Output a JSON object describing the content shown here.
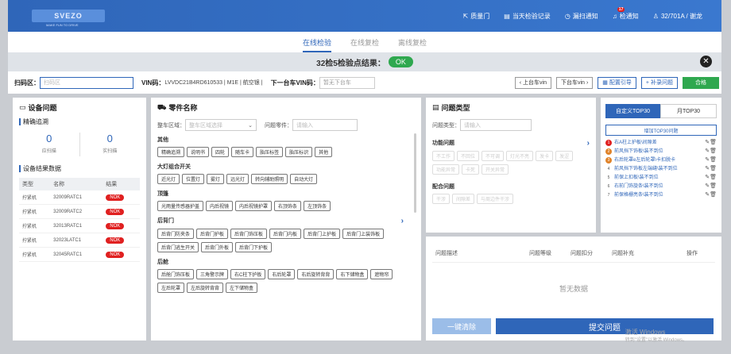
{
  "header": {
    "logo": "SVEZO",
    "logo_sub": "MAKE FUN TO DRIVE",
    "nav": [
      {
        "label": "质量门",
        "icon": "share-icon"
      },
      {
        "label": "当天检验记录",
        "icon": "list-icon"
      },
      {
        "label": "漏扫通知",
        "icon": "clock-icon"
      },
      {
        "label": "检通知",
        "icon": "bell-icon",
        "badge": "17"
      },
      {
        "label": "32/701A / 谢龙",
        "icon": "user-icon"
      }
    ]
  },
  "tabs": [
    "在线检验",
    "在线复检",
    "离线复检"
  ],
  "result": {
    "label": "32检5检验点结果：",
    "status": "OK"
  },
  "scan": {
    "scan_label": "扫码区：",
    "scan_placeholder": "扫码区",
    "vin_label": "VIN码：",
    "vin_value": "LVVDC21B4RD610533 | M1E | 航空银 |",
    "next_label": "下一台车VIN码：",
    "next_placeholder": "暂无下台车",
    "buttons": {
      "prev": "上台车vin",
      "next": "下台车vin",
      "config": "配置引导",
      "supplement": "补录问题",
      "pass": "合格"
    }
  },
  "device": {
    "title": "设备问题",
    "precise": "精确追溯",
    "scanned_count": "0",
    "scanned_label": "应扫描",
    "actual_count": "0",
    "actual_label": "实扫描",
    "data_title": "设备结果数据",
    "cols": [
      "类型",
      "名称",
      "结果"
    ],
    "rows": [
      {
        "type": "拧紧机",
        "name": "32009RATC1",
        "result": "NOK"
      },
      {
        "type": "拧紧机",
        "name": "32009RATC2",
        "result": "NOK"
      },
      {
        "type": "拧紧机",
        "name": "32013RATC1",
        "result": "NOK"
      },
      {
        "type": "拧紧机",
        "name": "32023LATC1",
        "result": "NOK"
      },
      {
        "type": "拧紧机",
        "name": "32045RATC1",
        "result": "NOK"
      }
    ]
  },
  "parts": {
    "title": "零件名称",
    "area_label": "整车区域：",
    "area_placeholder": "整车区域选择",
    "part_label": "问题零件：",
    "part_placeholder": "请输入",
    "groups": [
      {
        "name": "其他",
        "items": [
          "精确追溯",
          "说明书",
          "四轮",
          "随车卡",
          "胎压标签",
          "胎压标识",
          "其他"
        ]
      },
      {
        "name": "大灯组合开关",
        "items": [
          "近光灯",
          "位置灯",
          "雾灯",
          "远光灯",
          "转向辅助照明",
          "自动大灯"
        ]
      },
      {
        "name": "顶篷",
        "items": [
          "光雨量传感器护盖",
          "内后视镜",
          "内后视镜护罩",
          "右顶饰条",
          "左顶饰条"
        ]
      },
      {
        "name": "后背门",
        "items": [
          "后背门防夹条",
          "后背门护板",
          "后背门饰压板",
          "后背门内板",
          "后背门上护板",
          "后背门上装饰板",
          "后背门逃生开关",
          "后背门外板",
          "后背门下护板"
        ]
      },
      {
        "name": "后舱",
        "items": [
          "后舱门饰压板",
          "三角警示牌",
          "右C柱下护板",
          "右后轮罩",
          "右后旋转背背",
          "右下储物盒",
          "遮物帘",
          "左后轮罩",
          "左后旋转背背",
          "左下储物盒"
        ]
      }
    ]
  },
  "ptype": {
    "title": "问题类型",
    "label": "问题类型：",
    "placeholder": "请输入",
    "groups": [
      {
        "name": "功能问题",
        "items": [
          "不工作",
          "不回位",
          "不可调",
          "灯光不亮",
          "发卡",
          "发涩",
          "功能异常",
          "卡死",
          "开关异常"
        ]
      },
      {
        "name": "配合问题",
        "items": [
          "干涉",
          "间隙差",
          "与周边件干涉"
        ]
      }
    ],
    "table_cols": [
      "问题描述",
      "问题等级",
      "问题扣分",
      "问题补充",
      "操作"
    ],
    "empty": "暂无数据",
    "clear_btn": "一键清除",
    "submit_btn": "提交问题"
  },
  "top30": {
    "tab_custom": "自定义TOP30",
    "tab_month": "月TOP30",
    "add_btn": "增加TOP30问题",
    "items": [
      {
        "n": "1",
        "text": "右A柱上护板\\间隙差",
        "color": "#e02020"
      },
      {
        "n": "2",
        "text": "前风挡下饰板\\装不到位",
        "color": "#e0832a"
      },
      {
        "n": "3",
        "text": "右后轮罩e左后轮罩\\卡扣脱卡",
        "color": "#e0832a"
      },
      {
        "n": "4",
        "text": "前风挡下饰板左端缝\\装不到位",
        "color": "#777"
      },
      {
        "n": "5",
        "text": "前保上扣板\\装不到位",
        "color": "#777"
      },
      {
        "n": "6",
        "text": "右前门饰旋条\\装不到位",
        "color": "#777"
      },
      {
        "n": "7",
        "text": "前保格栅亮条\\装不到位",
        "color": "#777"
      }
    ]
  },
  "watermark": {
    "line1": "激活 Windows",
    "line2": "转到\"设置\"以激活 Windows。"
  }
}
